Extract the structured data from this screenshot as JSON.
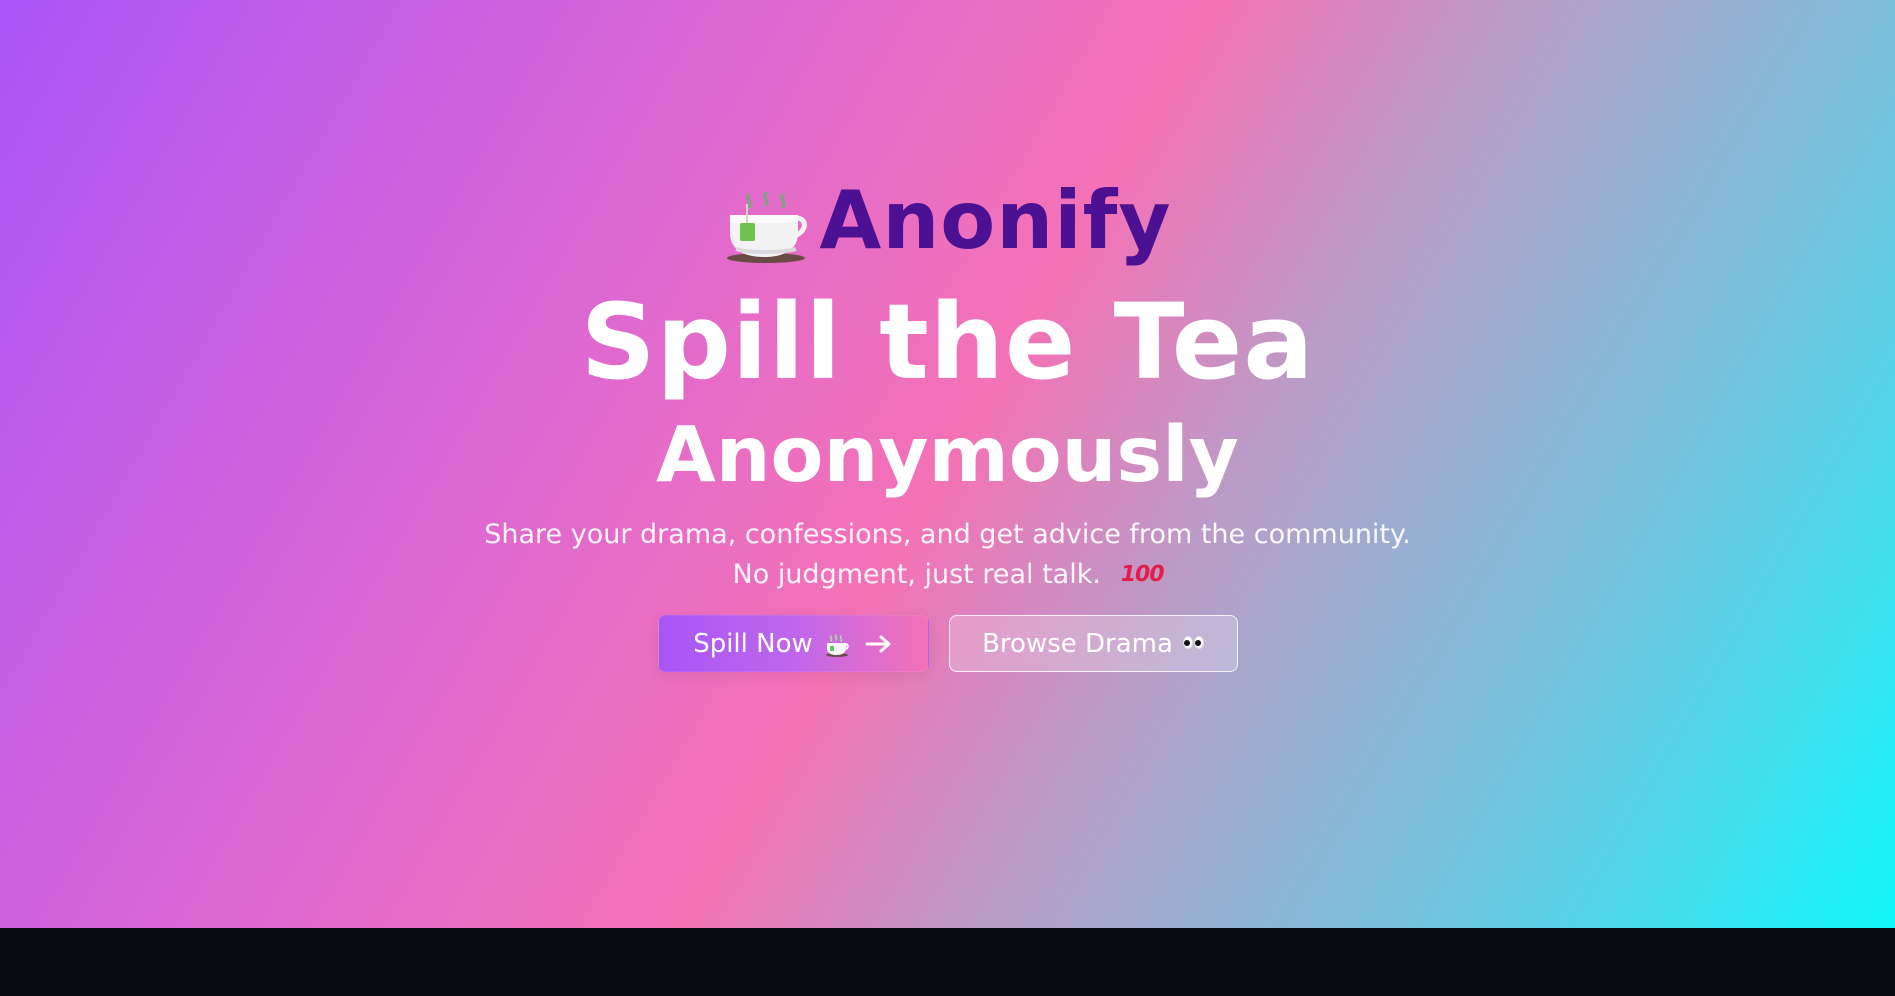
{
  "brand": {
    "name": "Anonify",
    "icon": "tea-cup-icon"
  },
  "hero": {
    "headline": "Spill the Tea",
    "subheadline": "Anonymously",
    "description_line_1": "Share your drama, confessions, and get advice from the community.",
    "description_line_2": "No judgment, just real talk.",
    "description_icon": "hundred-points-icon"
  },
  "actions": {
    "primary_label": "Spill Now",
    "primary_icon": "tea-cup-icon",
    "primary_secondary_icon": "arrow-right-icon",
    "secondary_label": "Browse Drama",
    "secondary_icon": "eyes-icon"
  },
  "colors": {
    "brand": "#4c1192",
    "hero_text": "#ffffff",
    "bottom_bar": "#0a0b0d"
  }
}
